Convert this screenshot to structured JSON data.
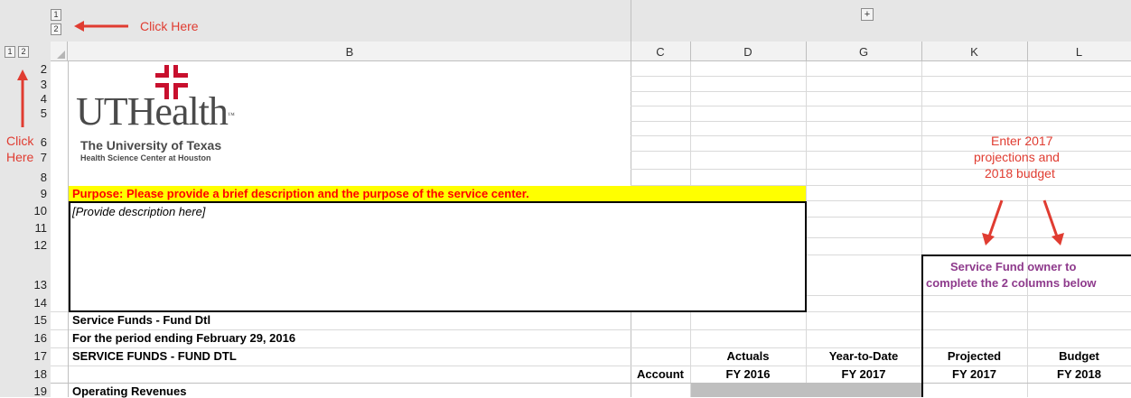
{
  "outline": {
    "column_levels": [
      "1",
      "2"
    ],
    "row_levels": [
      "1",
      "2"
    ],
    "expand_symbol": "+"
  },
  "annotations": {
    "click_here_top": "Click Here",
    "click_here_left_1": "Click",
    "click_here_left_2": "Here",
    "enter_note": [
      "Enter 2017",
      "projections and",
      "2018 budget"
    ]
  },
  "columns": [
    "B",
    "C",
    "D",
    "G",
    "K",
    "L"
  ],
  "row_numbers": [
    "2",
    "3",
    "4",
    "5",
    "6",
    "7",
    "8",
    "9",
    "10",
    "11",
    "12",
    "13",
    "14",
    "15",
    "16",
    "17",
    "18",
    "19"
  ],
  "logo": {
    "wordmark": "UTHealth",
    "tm": "™",
    "line1": "The University of Texas",
    "line2": "Health Science Center at Houston"
  },
  "cells": {
    "purpose": "Purpose: Please provide a brief description and the purpose of the service center.",
    "description": "[Provide description here]",
    "service_fund_note": [
      "Service Fund owner to",
      "complete the 2 columns below"
    ],
    "r15": "Service Funds - Fund Dtl",
    "r16": "For the period ending February 29, 2016",
    "r17": "SERVICE FUNDS - FUND DTL",
    "r17_D": "Actuals",
    "r17_G": "Year-to-Date",
    "r17_K": "Projected",
    "r17_L": "Budget",
    "r18_C": "Account",
    "r18_D": "FY 2016",
    "r18_G": "FY 2017",
    "r18_K": "FY 2017",
    "r18_L": "FY 2018",
    "r19": "Operating Revenues"
  },
  "colors": {
    "purpose_fill": "#ffff00",
    "annotation_red": "#e03c31",
    "note_purple": "#8e3a8c",
    "header_gray": "#e6e6e6"
  }
}
